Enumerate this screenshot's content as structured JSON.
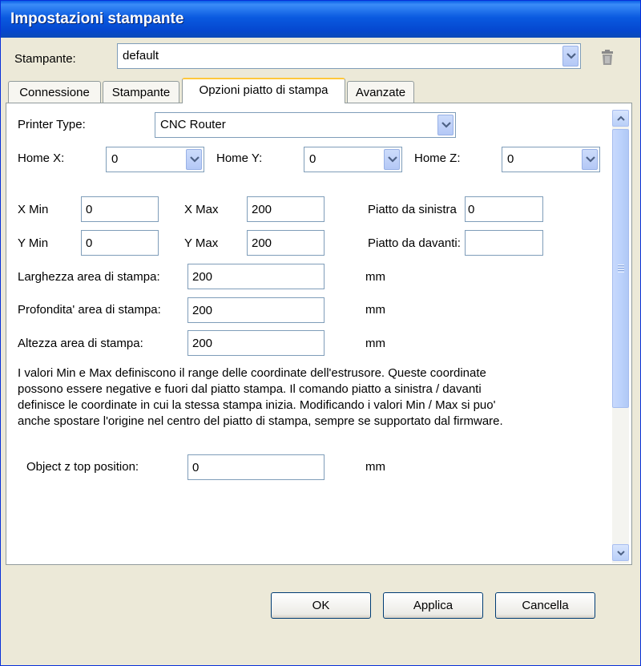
{
  "window": {
    "title": "Impostazioni stampante"
  },
  "printer_row": {
    "label": "Stampante:",
    "selected": "default",
    "delete_icon": "trash-icon"
  },
  "tabs": [
    {
      "label": "Connessione",
      "active": false
    },
    {
      "label": "Stampante",
      "active": false
    },
    {
      "label": "Opzioni piatto di stampa",
      "active": true
    },
    {
      "label": "Avanzate",
      "active": false
    }
  ],
  "printer_type": {
    "label": "Printer Type:",
    "selected": "CNC Router"
  },
  "home": {
    "x": {
      "label": "Home X:",
      "selected": "0"
    },
    "y": {
      "label": "Home Y:",
      "selected": "0"
    },
    "z": {
      "label": "Home Z:",
      "selected": "0"
    }
  },
  "xmin": {
    "label": "X Min",
    "value": "0"
  },
  "xmax": {
    "label": "X Max",
    "value": "200"
  },
  "ymin": {
    "label": "Y Min",
    "value": "0"
  },
  "ymax": {
    "label": "Y Max",
    "value": "200"
  },
  "bed_left": {
    "label": "Piatto da sinistra",
    "value": "0"
  },
  "bed_front": {
    "label": "Piatto da davanti:",
    "value": ""
  },
  "width": {
    "label": "Larghezza area di stampa:",
    "value": "200",
    "unit": "mm"
  },
  "depth": {
    "label": "Profondita' area di stampa:",
    "value": "200",
    "unit": "mm"
  },
  "height": {
    "label": "Altezza area di stampa:",
    "value": "200",
    "unit": "mm"
  },
  "info_lines": [
    "I valori Min e Max definiscono il range delle coordinate dell'estrusore. Queste coordinate",
    "possono essere negative e fuori dal piatto stampa. Il comando piatto a sinistra / davanti",
    "definisce le coordinate in cui la stessa stampa inizia. Modificando i valori Min / Max si puo'",
    "anche spostare l'origine nel centro del piatto di stampa, sempre se supportato dal firmware."
  ],
  "object_z": {
    "label": "Object z top position:",
    "value": "0",
    "unit": "mm"
  },
  "buttons": {
    "ok": "OK",
    "apply": "Applica",
    "cancel": "Cancella"
  }
}
